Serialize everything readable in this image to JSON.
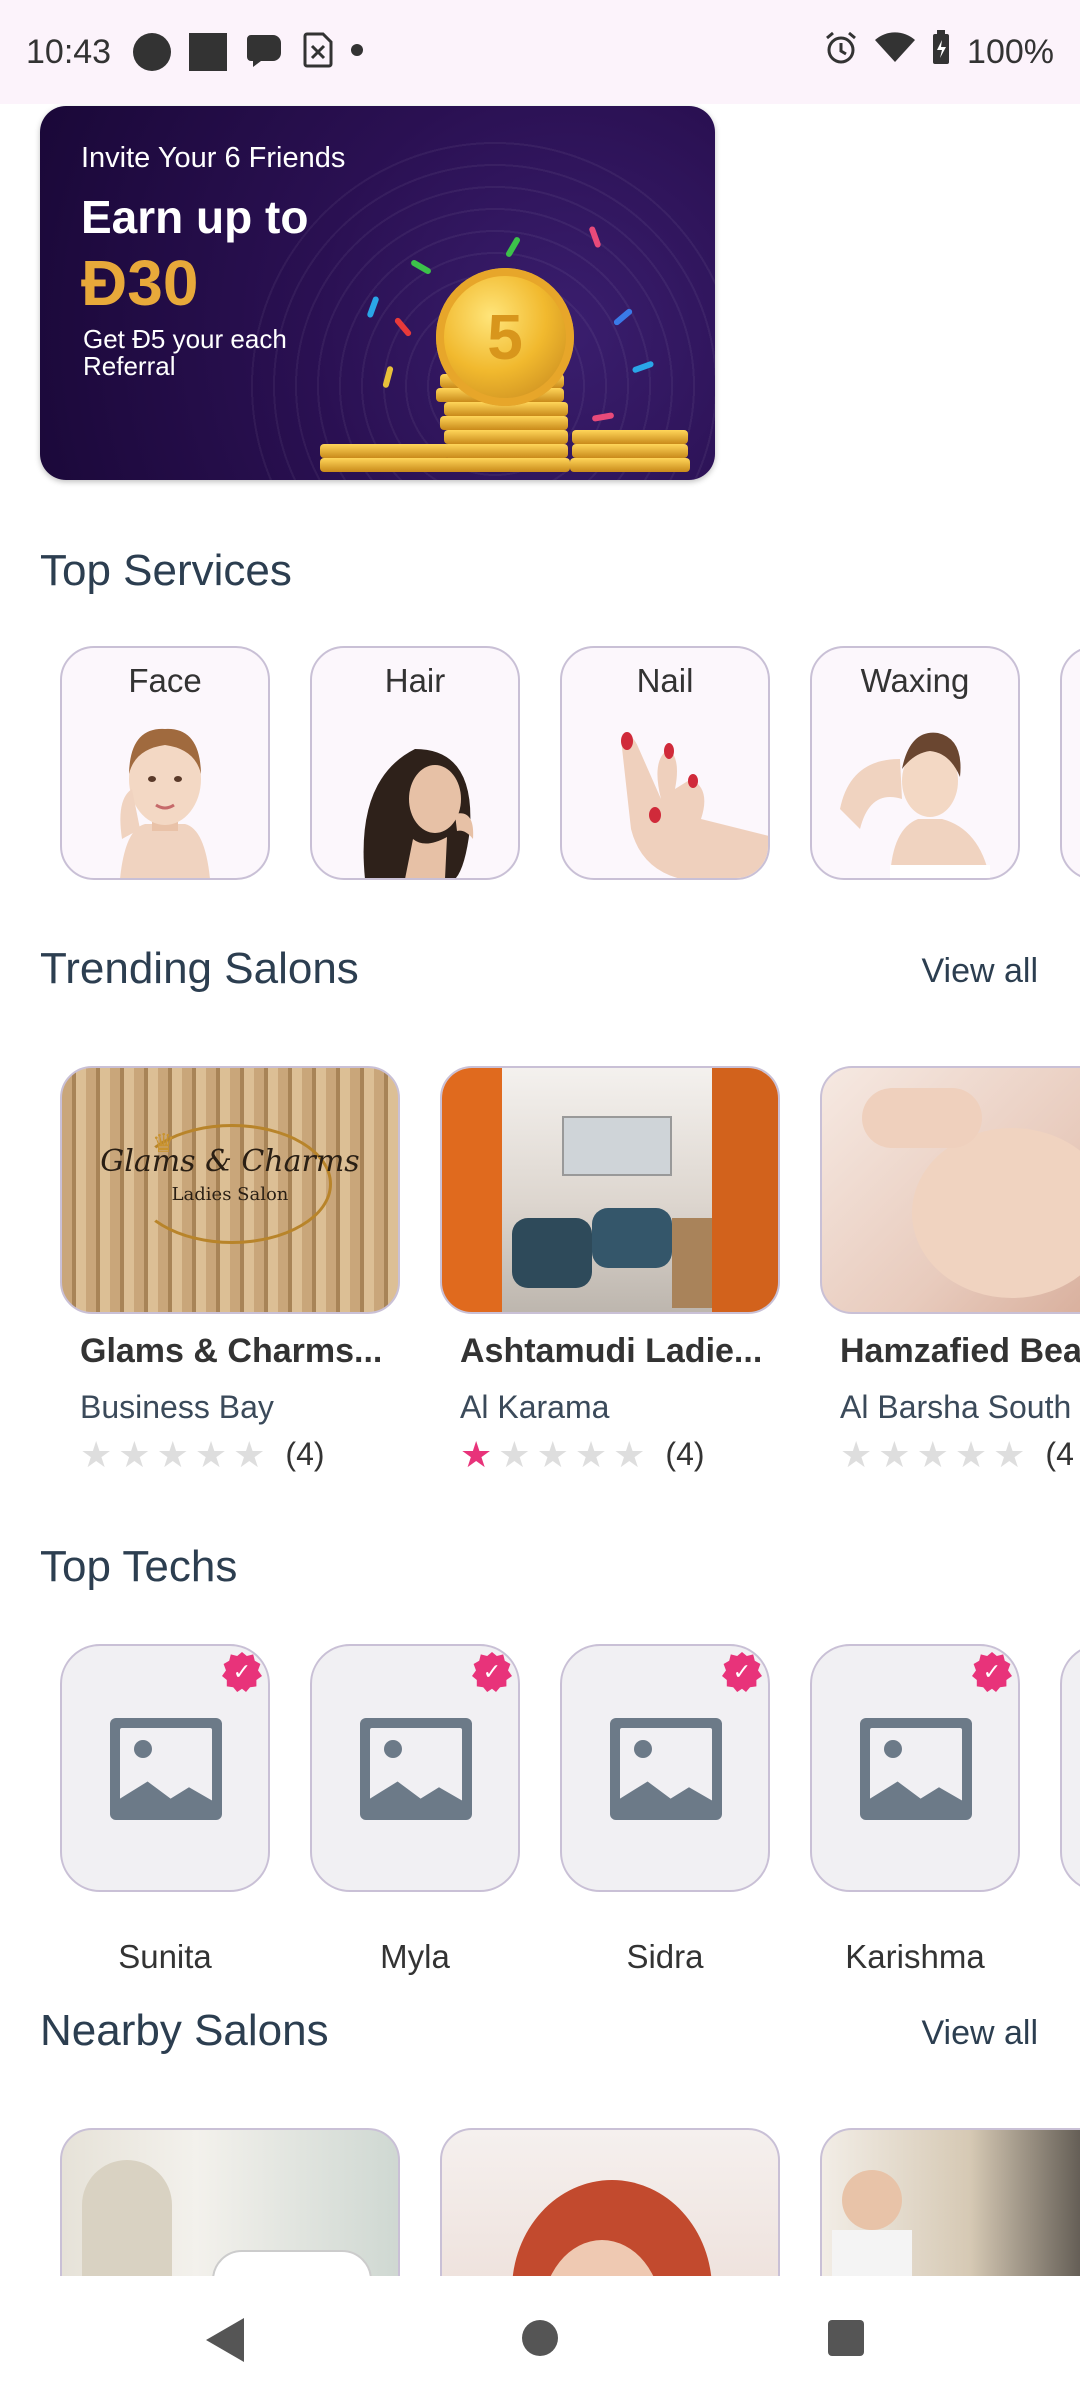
{
  "status_bar": {
    "time": "10:43",
    "battery": "100%"
  },
  "promo": {
    "line1": "Invite Your 6 Friends",
    "line2": "Earn up to",
    "amount": "Đ30",
    "sub": "Get Đ5 your each Referral",
    "coin_value": "5"
  },
  "sections": {
    "top_services": "Top Services",
    "trending_salons": "Trending Salons",
    "top_techs": "Top Techs",
    "nearby_salons": "Nearby Salons",
    "view_all": "View all"
  },
  "services": [
    {
      "label": "Face"
    },
    {
      "label": "Hair"
    },
    {
      "label": "Nail"
    },
    {
      "label": "Waxing"
    }
  ],
  "trending_salons": [
    {
      "name": "Glams & Charms...",
      "location": "Business Bay",
      "rating_count": "(4)",
      "stars": 0,
      "sign_line1": "Glams & Charms",
      "sign_line2": "Ladies Salon"
    },
    {
      "name": "Ashtamudi Ladie...",
      "location": "Al Karama",
      "rating_count": "(4)",
      "stars": 1
    },
    {
      "name": "Hamzafied Bea",
      "location": "Al Barsha South",
      "rating_count": "(4",
      "stars": 0
    }
  ],
  "techs": [
    {
      "name": "Sunita"
    },
    {
      "name": "Myla"
    },
    {
      "name": "Sidra"
    },
    {
      "name": "Karishma"
    }
  ],
  "colors": {
    "accent": "#e8337a",
    "promo_bg": "#2a1052",
    "gold": "#e8a93a",
    "status_bg": "#fcf3fb"
  }
}
